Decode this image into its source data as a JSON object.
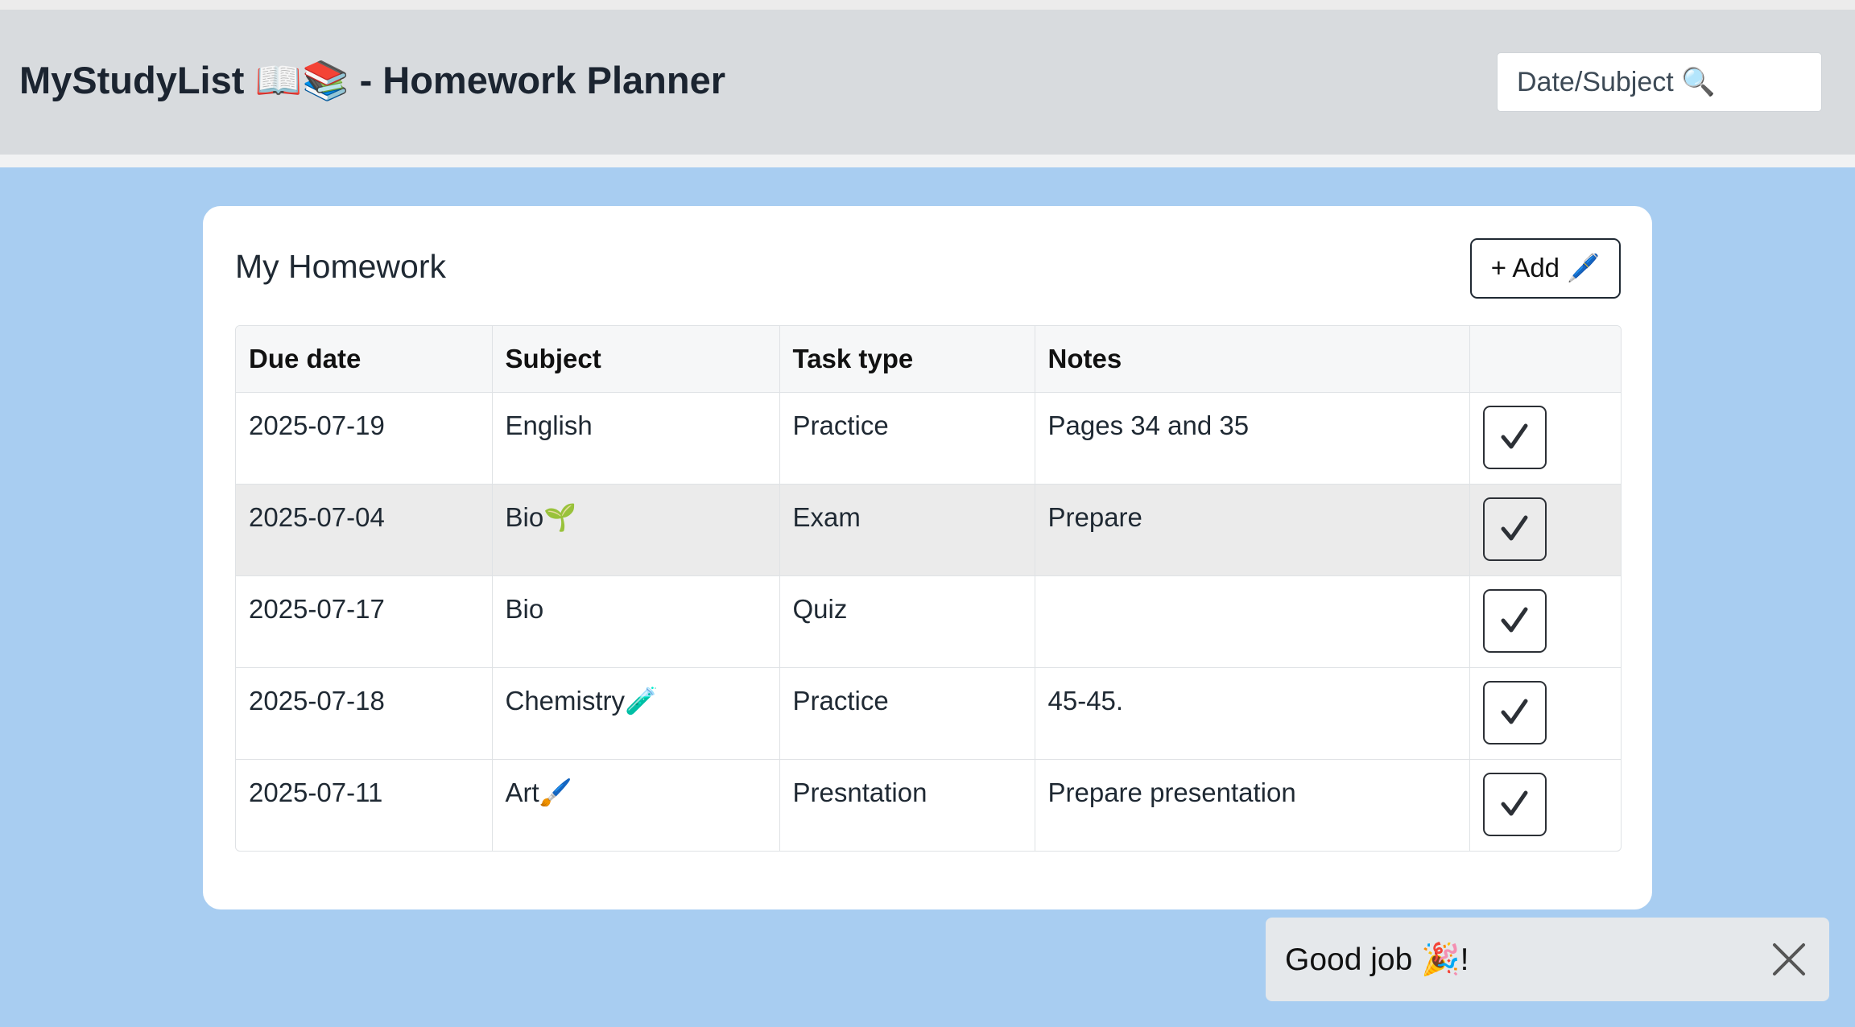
{
  "header": {
    "title": "MyStudyList 📖📚 - Homework Planner",
    "search_placeholder": "Date/Subject 🔍"
  },
  "main": {
    "title": "My Homework",
    "add_label": "+ Add 🖊️",
    "columns": [
      "Due date",
      "Subject",
      "Task type",
      "Notes",
      ""
    ],
    "rows": [
      {
        "due": "2025-07-19",
        "subject": "English",
        "type": "Practice",
        "notes": "Pages 34 and 35"
      },
      {
        "due": "2025-07-04",
        "subject": "Bio🌱",
        "type": "Exam",
        "notes": "Prepare"
      },
      {
        "due": "2025-07-17",
        "subject": "Bio",
        "type": "Quiz",
        "notes": ""
      },
      {
        "due": "2025-07-18",
        "subject": "Chemistry🧪",
        "type": "Practice",
        "notes": "45-45."
      },
      {
        "due": "2025-07-11",
        "subject": "Art🖌️",
        "type": "Presntation",
        "notes": "Prepare presentation"
      }
    ],
    "row_action_icon": "checkmark-icon"
  },
  "toast": {
    "message": "Good job 🎉!",
    "close_icon": "close-icon"
  },
  "colors": {
    "page_background": "#a8cdf1",
    "header_background": "#d8dbde",
    "card_background": "#ffffff",
    "highlighted_row": "#ebebeb",
    "toast_background": "#e5e8eb"
  }
}
